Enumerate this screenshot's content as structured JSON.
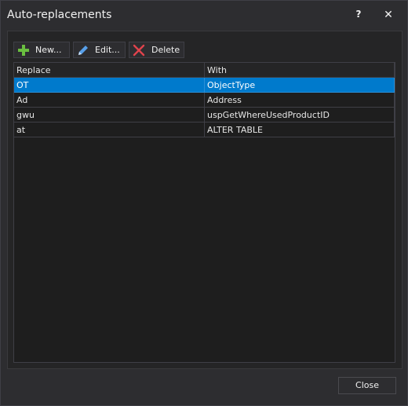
{
  "window": {
    "title": "Auto-replacements",
    "help_label": "?",
    "close_label": "✕"
  },
  "toolbar": {
    "new_label": "New...",
    "edit_label": "Edit...",
    "delete_label": "Delete"
  },
  "grid": {
    "columns": [
      "Replace",
      "With"
    ],
    "rows": [
      {
        "replace": "OT",
        "with": "ObjectType",
        "selected": true
      },
      {
        "replace": "Ad",
        "with": "Address",
        "selected": false
      },
      {
        "replace": "gwu",
        "with": "uspGetWhereUsedProductID",
        "selected": false
      },
      {
        "replace": "at",
        "with": "ALTER TABLE",
        "selected": false
      }
    ]
  },
  "footer": {
    "close_label": "Close"
  },
  "colors": {
    "accent": "#007acc",
    "add_icon": "#6abf40",
    "edit_icon": "#58a0ea",
    "delete_icon": "#e0434c"
  }
}
